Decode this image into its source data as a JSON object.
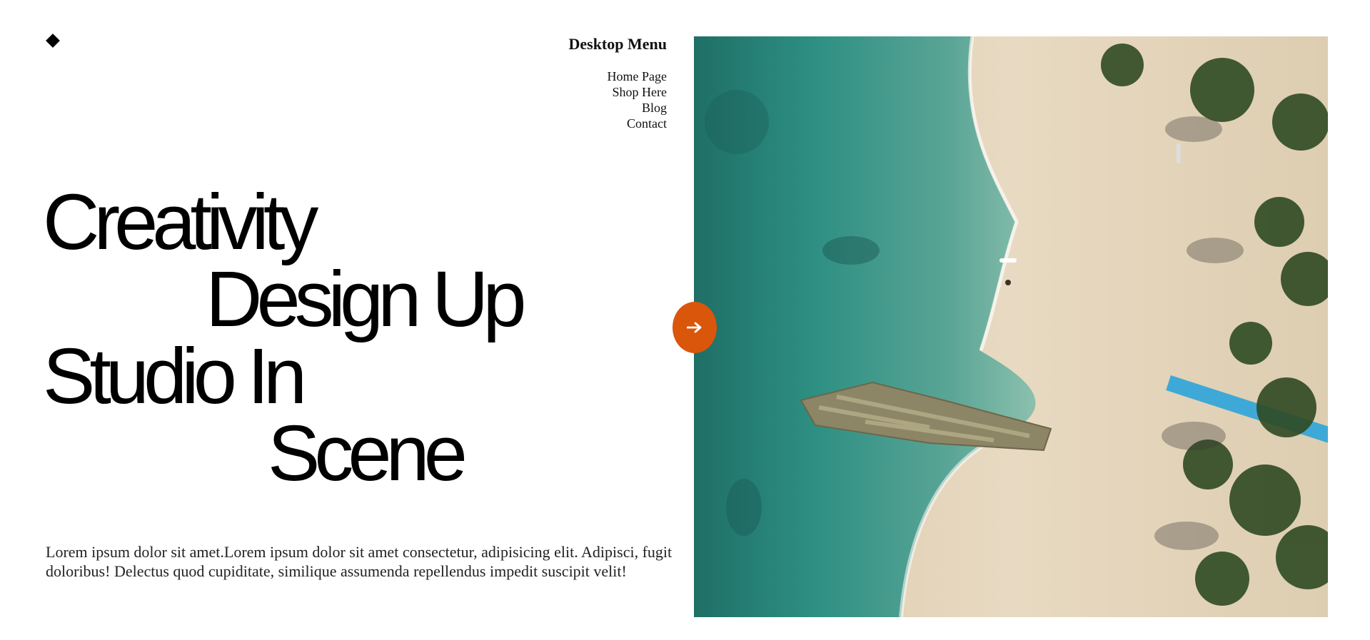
{
  "logo": {
    "icon": "diamond-logo-icon"
  },
  "menu": {
    "title": "Desktop Menu",
    "items": [
      {
        "label": "Home Page"
      },
      {
        "label": "Shop Here"
      },
      {
        "label": "Blog"
      },
      {
        "label": "Contact"
      }
    ]
  },
  "hero": {
    "line1": "Creativity",
    "line2": "Design Up",
    "line3": "Studio In",
    "line4": "Scene"
  },
  "intro": {
    "text": "Lorem ipsum dolor sit amet.Lorem ipsum dolor sit amet consectetur, adipisicing elit. Adipisci, fugit doloribus! Delectus quod cupiditate, similique assumenda repellendus impedit suscipit velit!"
  },
  "cta": {
    "icon": "arrow-right-icon",
    "color": "#d9560b"
  },
  "photo": {
    "subject": "aerial-beach-photo"
  }
}
